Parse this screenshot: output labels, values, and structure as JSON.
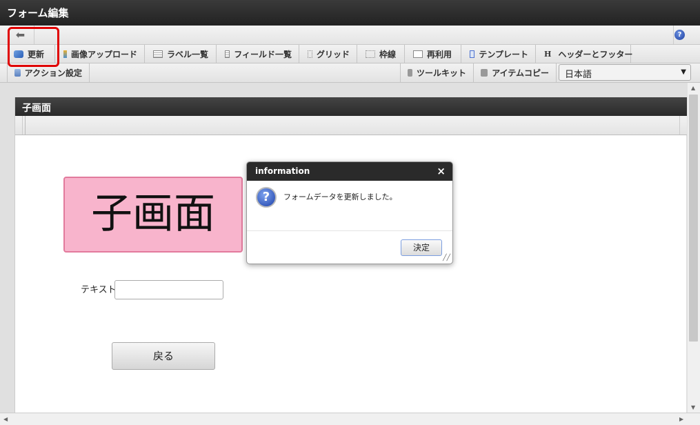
{
  "window": {
    "title": "フォーム編集"
  },
  "toolbar": {
    "back_icon": "arrow-left-icon",
    "help_icon": "help-icon"
  },
  "tabs_row1": [
    {
      "label": "更新",
      "icon": "update-icon"
    },
    {
      "label": "画像アップロード",
      "icon": "image-upload-icon"
    },
    {
      "label": "ラベル一覧",
      "icon": "list-icon"
    },
    {
      "label": "フィールド一覧",
      "icon": "list-icon"
    },
    {
      "label": "グリッド",
      "icon": "grid-icon"
    },
    {
      "label": "枠線",
      "icon": "border-icon"
    },
    {
      "label": "再利用",
      "icon": "copy-icon"
    },
    {
      "label": "テンプレート",
      "icon": "template-icon"
    },
    {
      "label": "ヘッダーとフッター",
      "icon": "header-icon",
      "glyph": "H"
    }
  ],
  "tabs_row2": [
    {
      "label": "アクション設定",
      "icon": "action-icon"
    },
    {
      "label": "ツールキット",
      "icon": "toolbox-icon"
    },
    {
      "label": "アイテムコピー",
      "icon": "toolbox-icon"
    }
  ],
  "language_select": {
    "value": "日本語"
  },
  "panel": {
    "title": "子画面",
    "banner": "子画面",
    "text_label": "テキスト",
    "text_value": "",
    "back_button": "戻る"
  },
  "dialog": {
    "title": "information",
    "message": "フォームデータを更新しました。",
    "ok": "決定",
    "close": "×",
    "icon_glyph": "?"
  },
  "colors": {
    "banner": "#f8b4cc",
    "highlight": "#e00000",
    "header": "#2a2a2a"
  }
}
